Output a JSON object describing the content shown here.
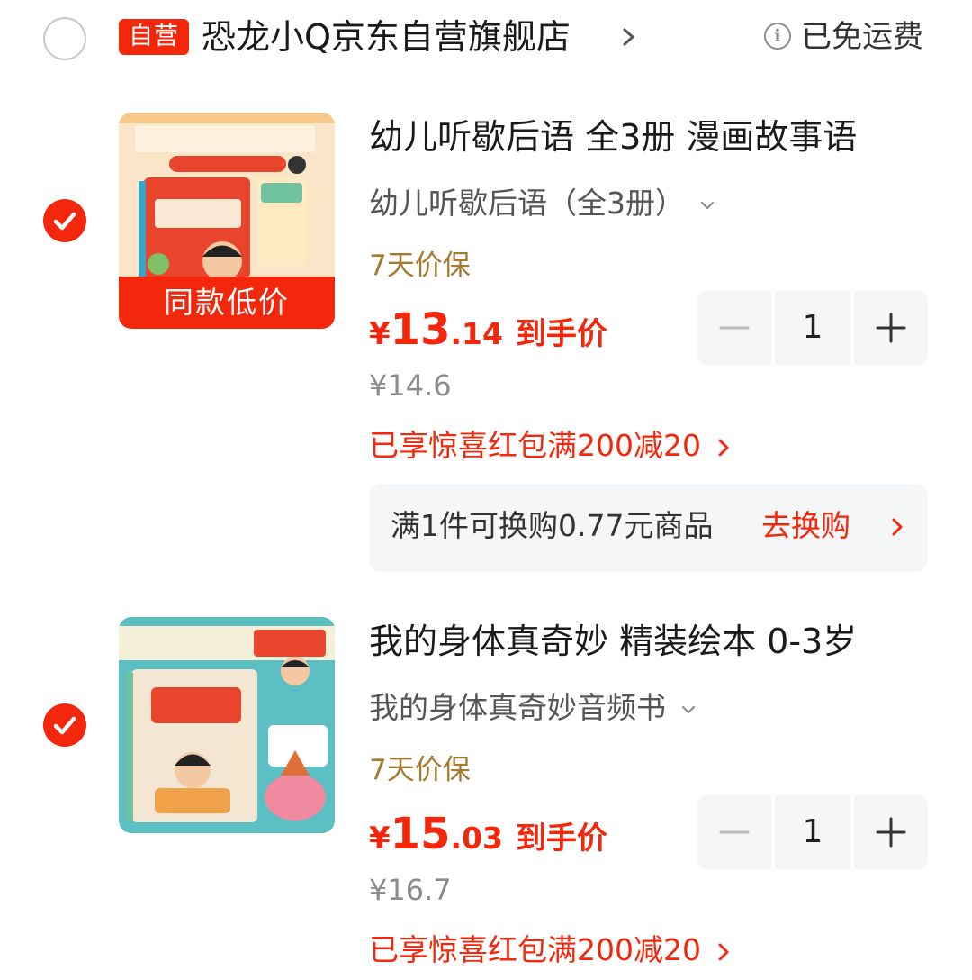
{
  "store": {
    "badge": "自营",
    "name": "恐龙小Q京东自营旗舰店",
    "shipping": "已免运费"
  },
  "items": [
    {
      "checked": true,
      "thumb_badge": "同款低价",
      "title": "幼儿听歇后语 全3册 漫画故事语",
      "spec": "幼儿听歇后语（全3册）",
      "guarantee": "7天价保",
      "price": {
        "currency": "¥",
        "integer": "13",
        "decimal": ".14",
        "label": "到手价"
      },
      "original_price": "¥14.6",
      "promo": "已享惊喜红包满200减20",
      "quantity": "1",
      "exchange": {
        "text": "满1件可换购0.77元商品",
        "link": "去换购"
      }
    },
    {
      "checked": true,
      "title": "我的身体真奇妙 精装绘本 0-3岁",
      "spec": "我的身体真奇妙音频书",
      "guarantee": "7天价保",
      "price": {
        "currency": "¥",
        "integer": "15",
        "decimal": ".03",
        "label": "到手价"
      },
      "original_price": "¥16.7",
      "promo": "已享惊喜红包满200减20",
      "quantity": "1"
    }
  ],
  "colors": {
    "accent": "#f2270c",
    "guarantee": "#a57a2f",
    "muted": "#8c8c8c"
  },
  "icons": [
    "chevron-right-icon",
    "info-icon",
    "checkmark-icon",
    "chevron-down-icon",
    "minus-icon",
    "plus-icon"
  ]
}
